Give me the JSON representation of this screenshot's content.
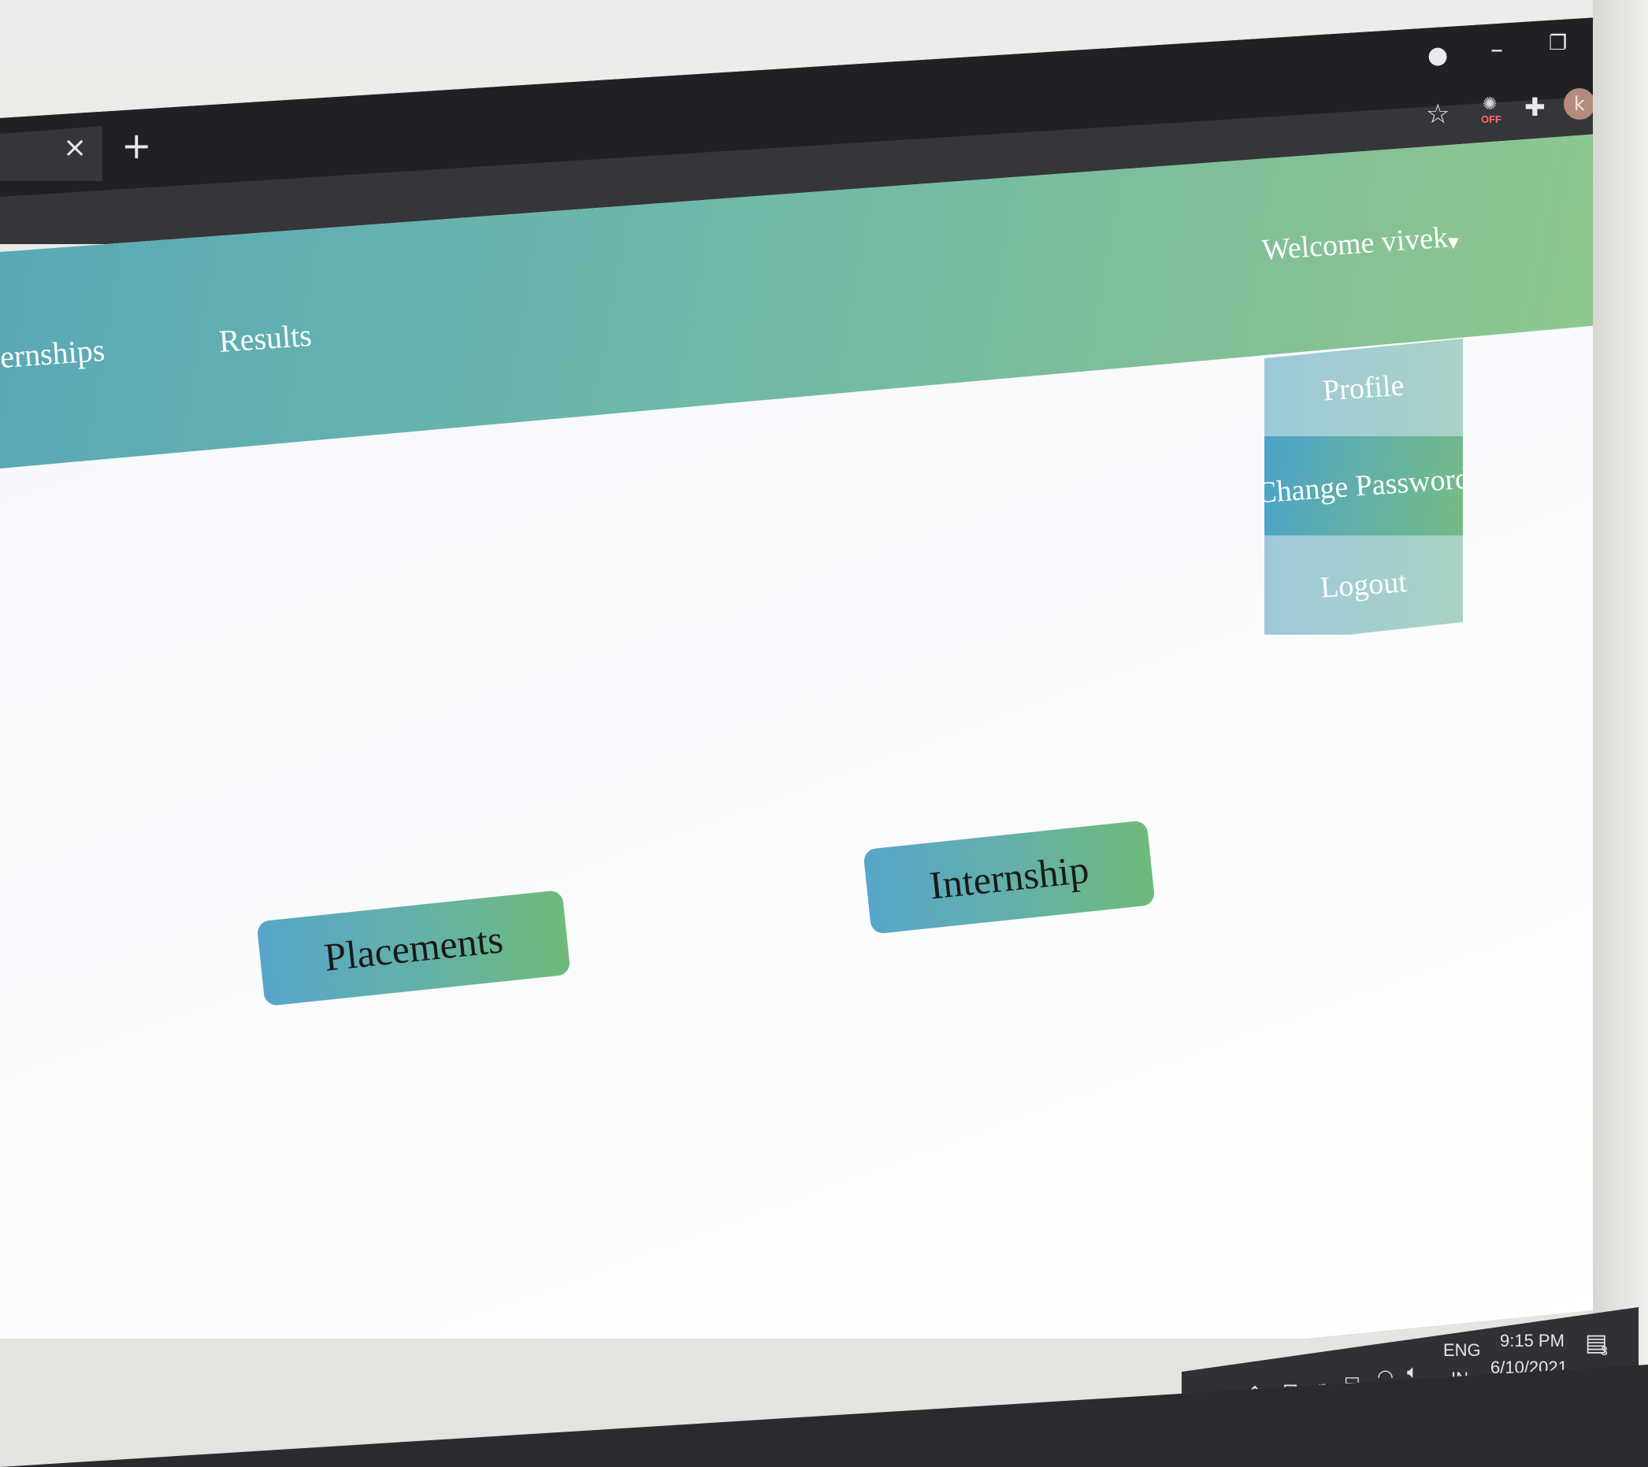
{
  "browser": {
    "tab_close_glyph": "×",
    "new_tab_glyph": "+",
    "window_controls": {
      "minimize": "–",
      "restore": "❐",
      "close": "✕"
    },
    "toolbar": {
      "bookmark_icon": "star-icon",
      "extension_badge": "OFF",
      "extensions_icon": "puzzle-icon",
      "profile_initial": "k",
      "menu_icon": "⋮"
    }
  },
  "navbar": {
    "links": [
      "ernships",
      "Results"
    ],
    "welcome": "Welcome vivek",
    "caret": "▼"
  },
  "dropdown": {
    "items": [
      "Profile",
      "Change Password",
      "Logout"
    ]
  },
  "main": {
    "buttons": [
      "Placements",
      "Internship"
    ]
  },
  "colors": {
    "nav_gradient_start": "#58a7b7",
    "nav_gradient_end": "#8fc98d",
    "button_gradient_start": "#56a6c9",
    "button_gradient_end": "#6fbb7a"
  },
  "taskbar": {
    "language": "ENG",
    "region": "IN",
    "time": "9:15 PM",
    "date": "6/10/2021",
    "notification_count": "3"
  }
}
